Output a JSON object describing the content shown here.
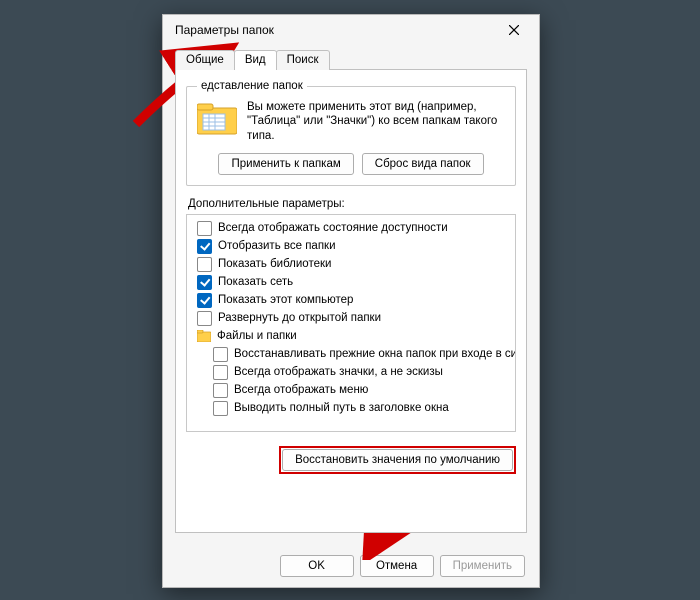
{
  "dialog": {
    "title": "Параметры папок",
    "tabs": {
      "general": "Общие",
      "view": "Вид",
      "search": "Поиск"
    },
    "folderViews": {
      "legend": "едставление папок",
      "text": "Вы можете применить этот вид (например, \"Таблица\" или \"Значки\") ко всем папкам такого типа.",
      "applyBtn": "Применить к папкам",
      "resetBtn": "Сброс вида папок"
    },
    "advanced": {
      "label": "Дополнительные параметры:",
      "items": [
        {
          "checked": false,
          "text": "Всегда отображать состояние доступности"
        },
        {
          "checked": true,
          "text": "Отобразить все папки"
        },
        {
          "checked": false,
          "text": "Показать библиотеки"
        },
        {
          "checked": true,
          "text": "Показать сеть"
        },
        {
          "checked": true,
          "text": "Показать этот компьютер"
        },
        {
          "checked": false,
          "text": "Развернуть до открытой папки"
        }
      ],
      "folderNode": "Файлы и папки",
      "subitems": [
        {
          "checked": false,
          "text": "Восстанавливать прежние окна папок при входе в си"
        },
        {
          "checked": false,
          "text": "Всегда отображать значки, а не эскизы"
        },
        {
          "checked": false,
          "text": "Всегда отображать меню"
        },
        {
          "checked": false,
          "text": "Выводить полный путь в заголовке окна"
        }
      ]
    },
    "restoreBtn": "Восстановить значения по умолчанию",
    "footer": {
      "ok": "OK",
      "cancel": "Отмена",
      "apply": "Применить"
    }
  }
}
